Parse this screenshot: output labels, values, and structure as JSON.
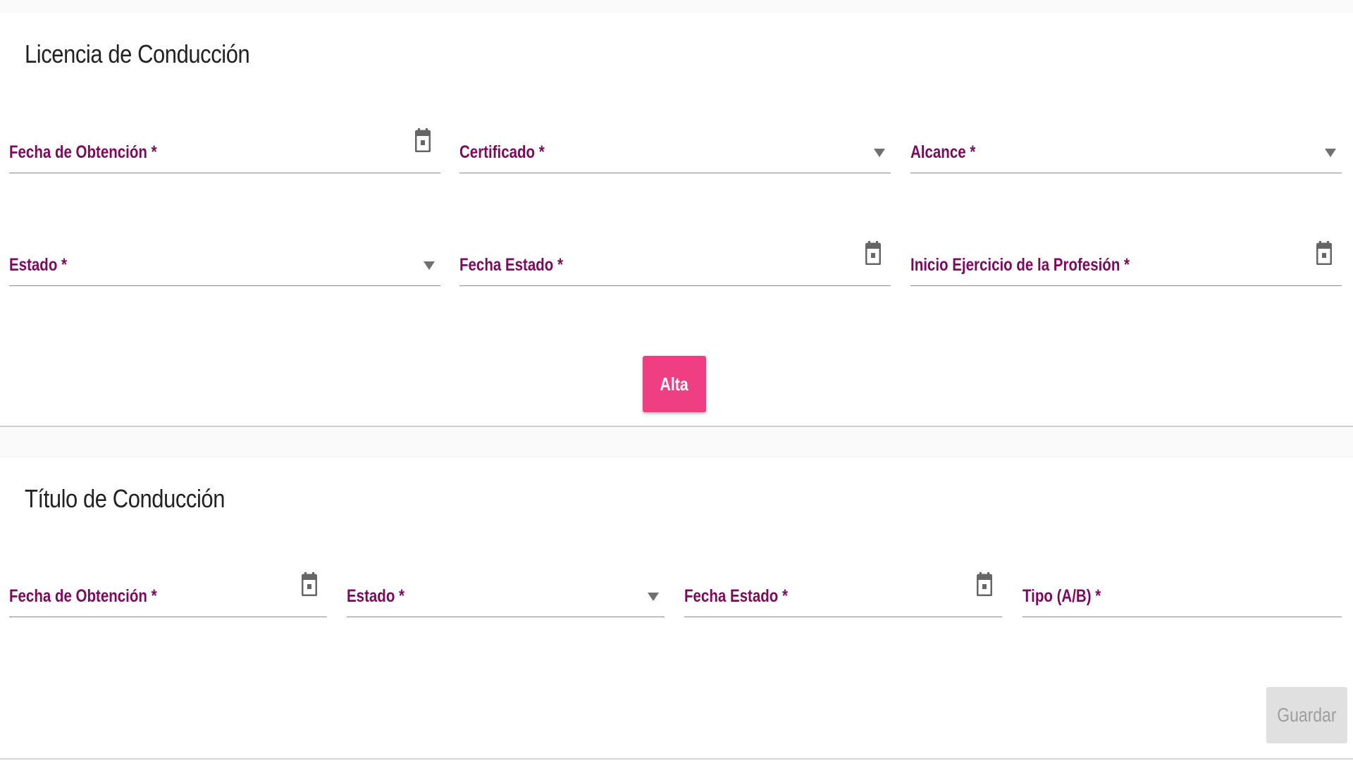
{
  "licencia": {
    "title": "Licencia de Conducción",
    "fields": {
      "fecha_obtencion": "Fecha de Obtención *",
      "certificado": "Certificado *",
      "alcance": "Alcance *",
      "estado": "Estado *",
      "fecha_estado": "Fecha Estado *",
      "inicio_ejercicio": "Inicio Ejercicio de la Profesión *"
    },
    "alta_button": "Alta"
  },
  "titulo": {
    "title": "Título de Conducción",
    "fields": {
      "fecha_obtencion": "Fecha de Obtención *",
      "estado": "Estado *",
      "fecha_estado": "Fecha Estado *",
      "tipo": "Tipo (A/B) *"
    },
    "guardar_button": "Guardar"
  },
  "colors": {
    "label": "#7b0a5e",
    "accent_button": "#f03e83",
    "disabled_button": "#e0e0e0",
    "disabled_text": "#9e9e9e"
  },
  "icons": {
    "date": "calendar-icon",
    "select": "dropdown-arrow-icon"
  }
}
